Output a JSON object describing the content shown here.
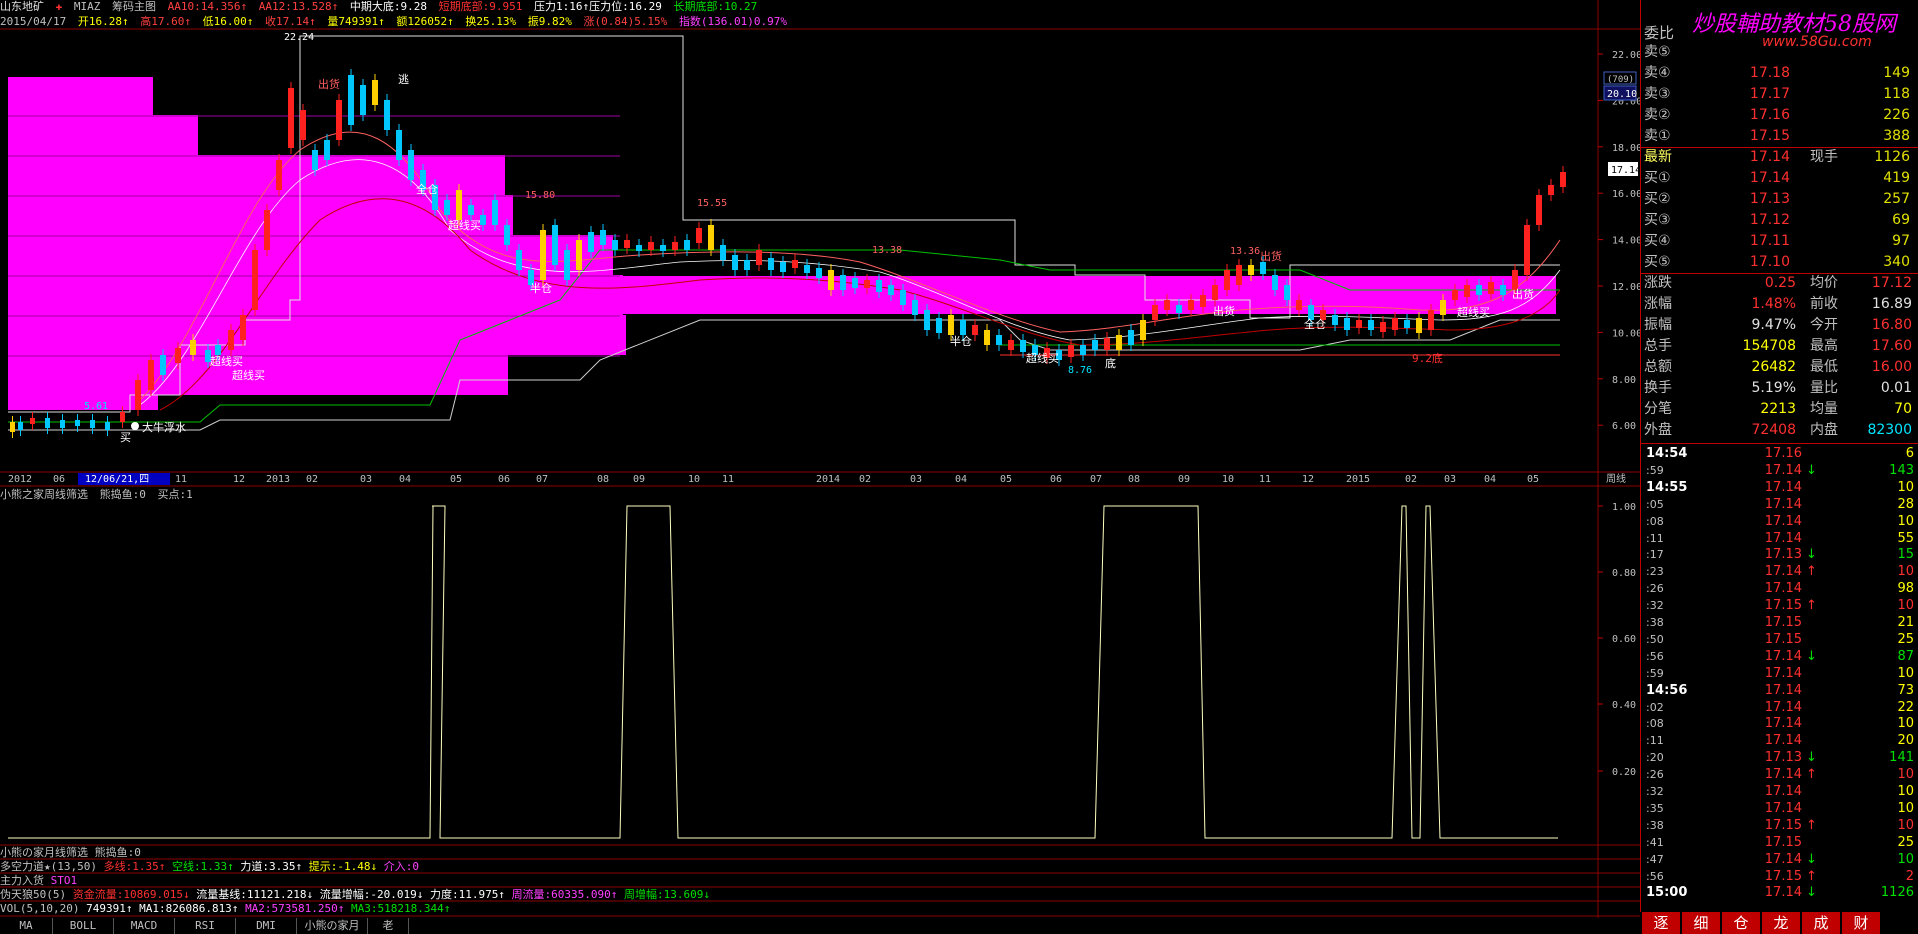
{
  "stock": {
    "name": "山东地矿",
    "code": "MIAZ",
    "main_title": "筹码主图"
  },
  "header": {
    "aa10": "AA10:14.356↑",
    "aa12": "AA12:13.528↑",
    "mid": "中期大底:9.28",
    "short": "短期底部:9.951",
    "pressure": "压力1:16↑压力位:16.29",
    "long": "长期底部:10.27",
    "date": "2015/04/17",
    "open": "开16.28↑",
    "high": "高17.60↑",
    "low": "低16.00↑",
    "close": "收17.14↑",
    "vol": "量749391↑",
    "amount": "额126052↑",
    "turnover": "换25.13%",
    "amp": "振9.82%",
    "change": "涨(0.84)5.15%",
    "index": "指数(136.01)0.97%"
  },
  "price_axis": [
    "22.00",
    "20.00",
    "18.00",
    "16.00",
    "14.00",
    "12.00",
    "10.00",
    "8.00",
    "6.00"
  ],
  "price_tag": {
    "badge": "(709)",
    "value": "20.10",
    "current": "17.14"
  },
  "time_axis": [
    "2012",
    "06",
    "12/06/21,四",
    "11",
    "12",
    "2013",
    "02",
    "03",
    "04",
    "05",
    "06",
    "07",
    "08",
    "09",
    "10",
    "11",
    "2014",
    "02",
    "03",
    "04",
    "05",
    "06",
    "07",
    "08",
    "09",
    "10",
    "11",
    "12",
    "2015",
    "02",
    "03",
    "04",
    "05"
  ],
  "period": "周线",
  "annotations": {
    "a22": "22.24",
    "a1580": "15.80",
    "a1555": "15.55",
    "a1338": "13.38",
    "a1336": "13.36",
    "a561": "5.61",
    "a876": "8.76",
    "exit1": "出货",
    "exit2": "出货",
    "exit3": "出货",
    "exit4": "出货",
    "escape": "逃",
    "fullpos": "全仓",
    "fullpos2": "全仓",
    "ultra1": "超线买",
    "ultra2": "超线买",
    "ultra3": "超线买",
    "ultra4": "超线买",
    "ultra5": "超线买",
    "halfpos": "半仓",
    "halfpos2": "半仓",
    "bull": "大牛浮水",
    "buy": "买",
    "bottom": "底",
    "low": "9.2底"
  },
  "sub_indicator": {
    "title": "小熊之家周线筛选",
    "bear": "熊捣鱼:0",
    "buy": "买点:1",
    "axis": [
      "1.00",
      "0.80",
      "0.60",
      "0.40",
      "0.20"
    ]
  },
  "indicators": [
    {
      "name": "小熊の家月线筛选",
      "text": "熊捣鱼:0"
    },
    {
      "name": "多空力道★(13,50)",
      "text": "多线:1.35↑",
      "text2": "空线:1.33↑",
      "text3": "力道:3.35↑",
      "text4": "提示:-1.48↓",
      "text5": "介入:0"
    },
    {
      "name": "主力入货",
      "text": "STO1"
    },
    {
      "name": "伪天狼50(5)",
      "text": "资金流量:10869.015↓",
      "text2": "流量基线:11121.218↓",
      "text3": "流量增幅:-20.019↓",
      "text4": "力度:11.975↑",
      "text5": "周流量:60335.090↑",
      "text6": "周增幅:13.609↓"
    },
    {
      "name": "VOL(5,10,20)",
      "text": "749391↑",
      "text2": "MA1:826086.813↑",
      "text3": "MA2:573581.250↑",
      "text4": "MA3:518218.344↑"
    }
  ],
  "tabs": [
    "MA",
    "BOLL",
    "MACD",
    "RSI",
    "DMI",
    "小熊の家月",
    "老"
  ],
  "quote": {
    "weibi_label": "委比",
    "watermark": "炒股輔助教材58股网",
    "watermark_url": "www.58Gu.com",
    "asks": [
      {
        "label": "卖⑤",
        "price": "",
        "vol": ""
      },
      {
        "label": "卖④",
        "price": "17.18",
        "vol": "149"
      },
      {
        "label": "卖③",
        "price": "17.17",
        "vol": "118"
      },
      {
        "label": "卖②",
        "price": "17.16",
        "vol": "226"
      },
      {
        "label": "卖①",
        "price": "17.15",
        "vol": "388"
      }
    ],
    "last": {
      "label": "最新",
      "price": "17.14",
      "l2": "现手",
      "vol": "1126"
    },
    "bids": [
      {
        "label": "买①",
        "price": "17.14",
        "vol": "419"
      },
      {
        "label": "买②",
        "price": "17.13",
        "vol": "257"
      },
      {
        "label": "买③",
        "price": "17.12",
        "vol": "69"
      },
      {
        "label": "买④",
        "price": "17.11",
        "vol": "97"
      },
      {
        "label": "买⑤",
        "price": "17.10",
        "vol": "340"
      }
    ],
    "stats": [
      {
        "l1": "涨跌",
        "v1": "0.25",
        "l2": "均价",
        "v2": "17.12"
      },
      {
        "l1": "涨幅",
        "v1": "1.48%",
        "l2": "前收",
        "v2": "16.89"
      },
      {
        "l1": "振幅",
        "v1": "9.47%",
        "l2": "今开",
        "v2": "16.80"
      },
      {
        "l1": "总手",
        "v1": "154708",
        "l2": "最高",
        "v2": "17.60"
      },
      {
        "l1": "总额",
        "v1": "26482",
        "l2": "最低",
        "v2": "16.00"
      },
      {
        "l1": "换手",
        "v1": "5.19%",
        "l2": "量比",
        "v2": "0.01"
      },
      {
        "l1": "分笔",
        "v1": "2213",
        "l2": "均量",
        "v2": "70"
      },
      {
        "l1": "外盘",
        "v1": "72408",
        "l2": "内盘",
        "v2": "82300"
      }
    ]
  },
  "ticks": [
    {
      "t": "14:54",
      "bold": true,
      "p": "17.16",
      "a": "",
      "v": "6"
    },
    {
      "t": ":59",
      "p": "17.14",
      "a": "↓",
      "v": "143"
    },
    {
      "t": "14:55",
      "bold": true,
      "p": "17.14",
      "a": "",
      "v": "10"
    },
    {
      "t": ":05",
      "p": "17.14",
      "a": "",
      "v": "28"
    },
    {
      "t": ":08",
      "p": "17.14",
      "a": "",
      "v": "10"
    },
    {
      "t": ":11",
      "p": "17.14",
      "a": "",
      "v": "55"
    },
    {
      "t": ":17",
      "p": "17.13",
      "a": "↓",
      "v": "15"
    },
    {
      "t": ":23",
      "p": "17.14",
      "a": "↑",
      "v": "10"
    },
    {
      "t": ":26",
      "p": "17.14",
      "a": "",
      "v": "98"
    },
    {
      "t": ":32",
      "p": "17.15",
      "a": "↑",
      "v": "10"
    },
    {
      "t": ":38",
      "p": "17.15",
      "a": "",
      "v": "21"
    },
    {
      "t": ":50",
      "p": "17.15",
      "a": "",
      "v": "25"
    },
    {
      "t": ":56",
      "p": "17.14",
      "a": "↓",
      "v": "87"
    },
    {
      "t": ":59",
      "p": "17.14",
      "a": "",
      "v": "10"
    },
    {
      "t": "14:56",
      "bold": true,
      "p": "17.14",
      "a": "",
      "v": "73"
    },
    {
      "t": ":02",
      "p": "17.14",
      "a": "",
      "v": "22"
    },
    {
      "t": ":08",
      "p": "17.14",
      "a": "",
      "v": "10"
    },
    {
      "t": ":11",
      "p": "17.14",
      "a": "",
      "v": "20"
    },
    {
      "t": ":20",
      "p": "17.13",
      "a": "↓",
      "v": "141"
    },
    {
      "t": ":26",
      "p": "17.14",
      "a": "↑",
      "v": "10"
    },
    {
      "t": ":32",
      "p": "17.14",
      "a": "",
      "v": "10"
    },
    {
      "t": ":35",
      "p": "17.14",
      "a": "",
      "v": "10"
    },
    {
      "t": ":38",
      "p": "17.15",
      "a": "↑",
      "v": "10"
    },
    {
      "t": ":41",
      "p": "17.15",
      "a": "",
      "v": "25"
    },
    {
      "t": ":47",
      "p": "17.14",
      "a": "↓",
      "v": "10"
    },
    {
      "t": ":56",
      "p": "17.15",
      "a": "↑",
      "v": "2"
    },
    {
      "t": "15:00",
      "bold": true,
      "p": "17.14",
      "a": "↓",
      "v": "1126"
    }
  ],
  "bottom_tabs": [
    "逐",
    "细",
    "仓",
    "龙",
    "成",
    "财"
  ],
  "colors": {
    "up": "#ff3030",
    "down": "#00e6ff",
    "magenta": "#ff00ff",
    "yellow": "#ffff00",
    "white": "#ffffff",
    "green": "#00e000",
    "bg": "#000000"
  }
}
